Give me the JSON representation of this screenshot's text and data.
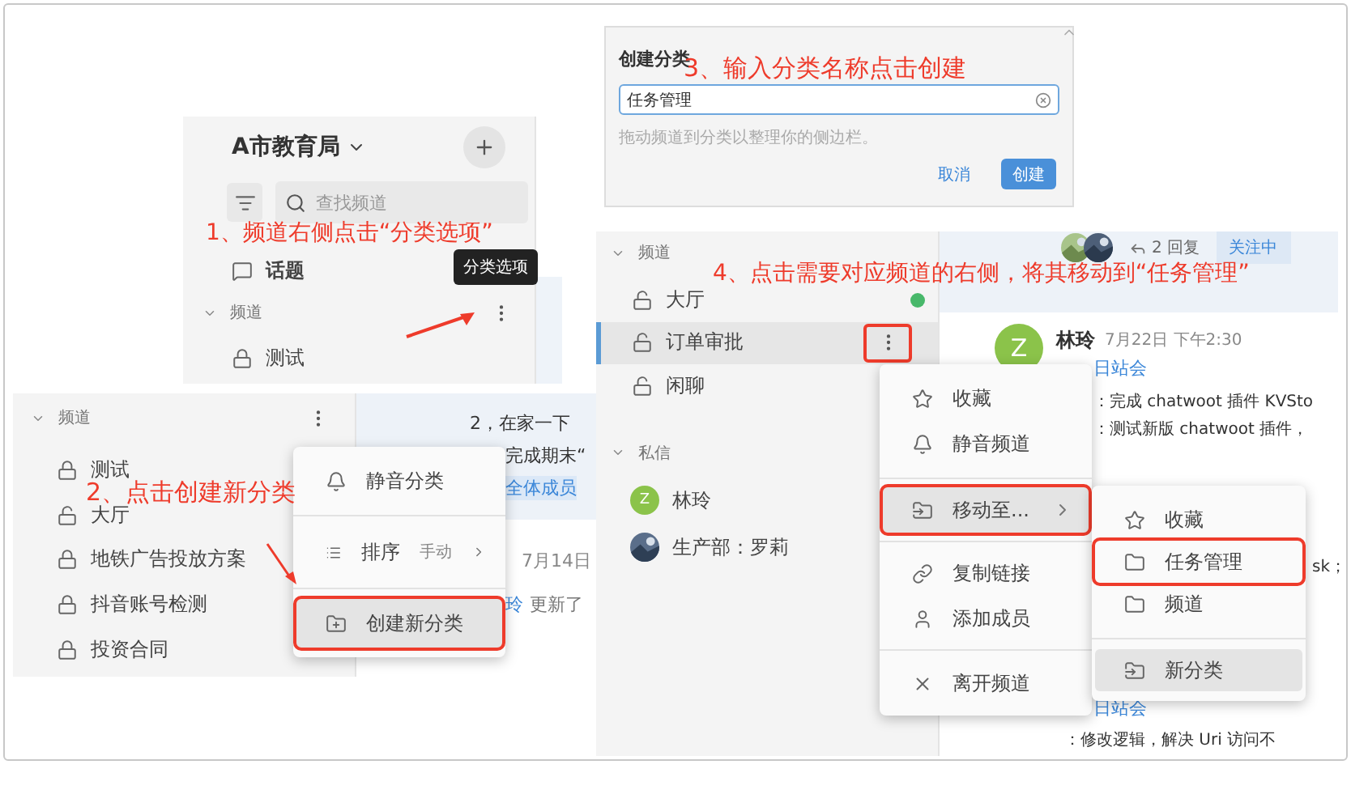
{
  "step1": {
    "workspace": "A市教育局",
    "search": {
      "placeholder": "查找频道"
    },
    "annotation": "1、频道右侧点击“分类选项”",
    "topics": "话题",
    "tooltip": "分类选项",
    "section": "频道",
    "channels": [
      {
        "name": "测试",
        "locked": true
      }
    ]
  },
  "step2": {
    "section": "频道",
    "annotation": "2、点击创建新分类",
    "channels": [
      {
        "name": "测试",
        "locked": true
      },
      {
        "name": "大厅",
        "locked": false
      },
      {
        "name": "地铁广告投放方案",
        "locked": true
      },
      {
        "name": "抖音账号检测",
        "locked": true
      },
      {
        "name": "投资合同",
        "locked": true
      }
    ],
    "message_lines": [
      {
        "kind": "list",
        "text": "2，在家一下"
      },
      {
        "kind": "plain",
        "text": "完成期末“"
      },
      {
        "kind": "mention",
        "text": "全体成员"
      },
      {
        "kind": "meta",
        "text": "7月14日"
      },
      {
        "kind": "activity",
        "user": "玲",
        "text": "更新了"
      }
    ],
    "menu": {
      "groups": [
        [
          {
            "label": "静音分类",
            "selected": false,
            "marked": false
          }
        ],
        [
          {
            "label": "排序",
            "value": "手动",
            "submenu": true,
            "selected": false,
            "marked": false
          }
        ],
        [
          {
            "label": "创建新分类",
            "selected": true,
            "marked": true
          }
        ]
      ]
    }
  },
  "step3": {
    "title": "创建分类",
    "annotation": "3、输入分类名称点击创建",
    "field": {
      "value": "任务管理"
    },
    "hint": "拖动频道到分类以整理你的侧边栏。",
    "buttons": [
      {
        "label": "取消",
        "kind": "text"
      },
      {
        "label": "创建",
        "kind": "primary"
      }
    ]
  },
  "step4": {
    "annotation": "4、点击需要对应频道的右侧，将其移动到“任务管理”",
    "section": "频道",
    "channels": [
      {
        "name": "大厅",
        "locked": false,
        "selected": false,
        "unread": true,
        "marked": false
      },
      {
        "name": "订单审批",
        "locked": false,
        "selected": true,
        "unread": false,
        "marked": true
      },
      {
        "name": "闲聊",
        "locked": false,
        "selected": false,
        "unread": false,
        "marked": false
      }
    ],
    "dm_section": "私信",
    "direct_messages": [
      {
        "name": "林玲",
        "kind": "letter",
        "avatar": "Z",
        "color": "#8bc34a"
      },
      {
        "name": "生产部：罗莉",
        "kind": "picture"
      }
    ],
    "thread": {
      "replies": "2 回复",
      "follow": "关注中"
    },
    "message": {
      "author": "林玲",
      "avatar": "Z",
      "time": "7月22日 下午2:30",
      "link": "日站会",
      "lines": [
        "：完成 chatwoot 插件 KVSto",
        "：测试新版 chatwoot 插件，"
      ]
    },
    "fragment": "sk；",
    "message2": {
      "link": "日站会",
      "line": "：修改逻辑，解决 Uri 访问不"
    },
    "menu": {
      "groups": [
        [
          {
            "label": "收藏",
            "submenu": false,
            "selected": false,
            "marked": false
          },
          {
            "label": "静音频道",
            "submenu": false,
            "selected": false,
            "marked": false
          }
        ],
        [
          {
            "label": "移动至...",
            "submenu": true,
            "selected": true,
            "marked": true
          }
        ],
        [
          {
            "label": "复制链接",
            "submenu": false,
            "selected": false,
            "marked": false
          },
          {
            "label": "添加成员",
            "submenu": false,
            "selected": false,
            "marked": false
          }
        ],
        [
          {
            "label": "离开频道",
            "submenu": false,
            "selected": false,
            "marked": false
          }
        ]
      ]
    },
    "submenu": {
      "groups": [
        [
          {
            "label": "收藏",
            "selected": false,
            "marked": false
          },
          {
            "label": "任务管理",
            "selected": false,
            "marked": true
          },
          {
            "label": "频道",
            "selected": false,
            "marked": false
          }
        ],
        [
          {
            "label": "新分类",
            "selected": true,
            "marked": false
          }
        ]
      ]
    }
  }
}
